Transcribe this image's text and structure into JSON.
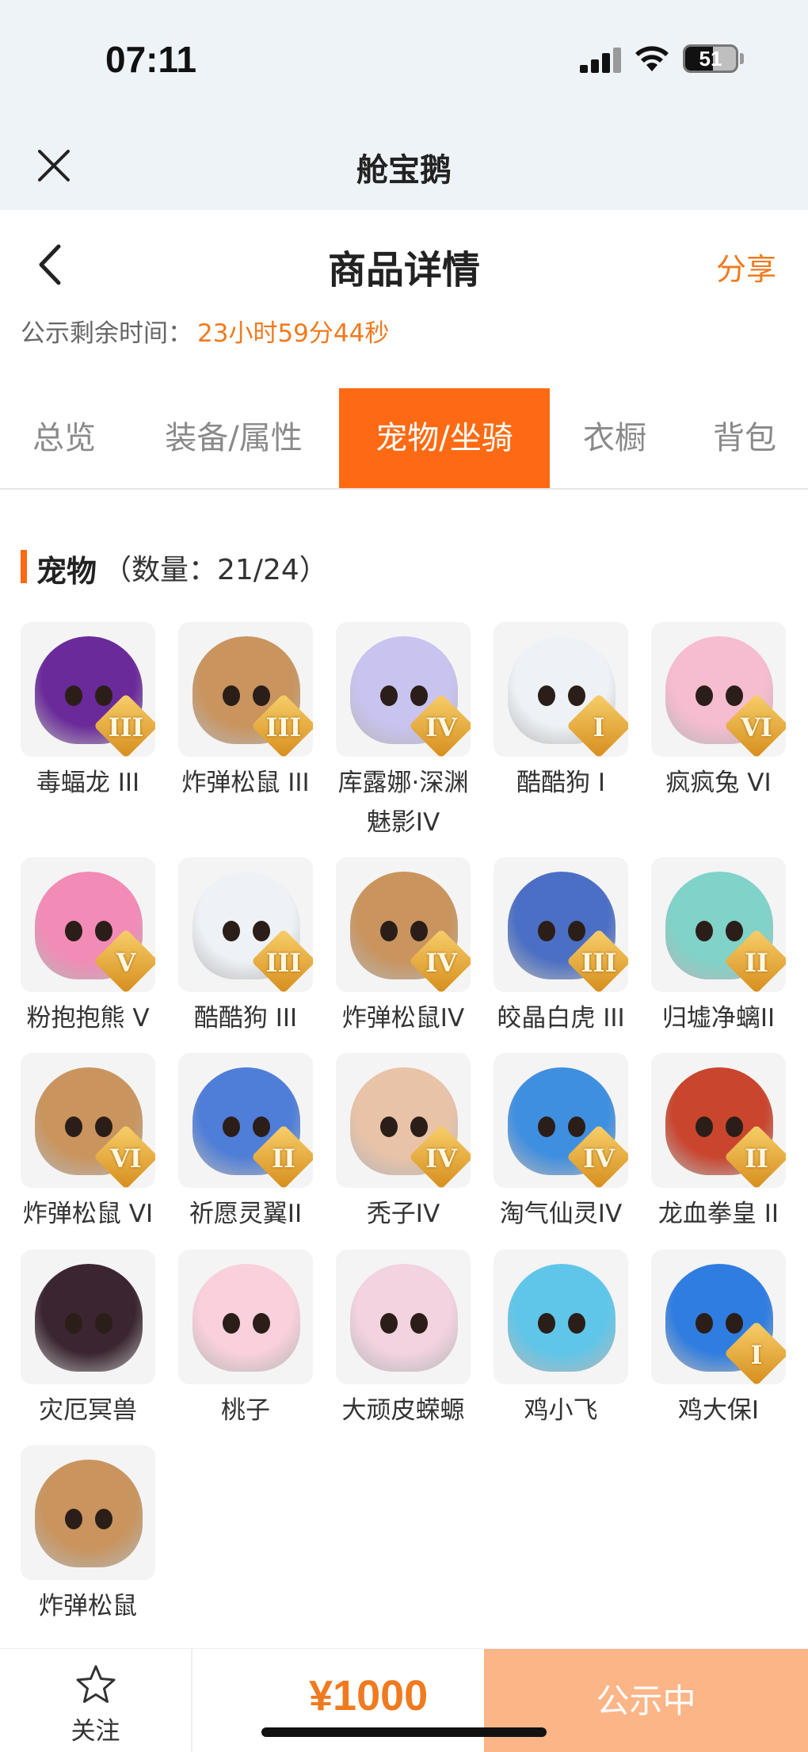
{
  "status_bar": {
    "time": "07:11",
    "battery": "51"
  },
  "app": {
    "title": "舱宝鹅"
  },
  "page": {
    "title": "商品详情",
    "share_label": "分享",
    "countdown_label": "公示剩余时间：",
    "countdown_value": "23小时59分44秒"
  },
  "tabs": [
    {
      "label": "总览",
      "active": false
    },
    {
      "label": "装备/属性",
      "active": false
    },
    {
      "label": "宠物/坐骑",
      "active": true
    },
    {
      "label": "衣橱",
      "active": false
    },
    {
      "label": "背包",
      "active": false
    }
  ],
  "section": {
    "title": "宠物",
    "count": "（数量：21/24）"
  },
  "pets": [
    {
      "name": "毒蝠龙 III",
      "tier": "III",
      "icon": "purple-dragon",
      "color": "#6a2a9a"
    },
    {
      "name": "炸弹松鼠 III",
      "tier": "III",
      "icon": "squirrel",
      "color": "#c9945e"
    },
    {
      "name": "库露娜·深渊魅影IV",
      "tier": "IV",
      "icon": "spirit-girl",
      "color": "#c9c3f0"
    },
    {
      "name": "酷酷狗 I",
      "tier": "I",
      "icon": "goggle-dog",
      "color": "#eef2f6"
    },
    {
      "name": "疯疯兔 VI",
      "tier": "VI",
      "icon": "bunny",
      "color": "#f6bcd0"
    },
    {
      "name": "粉抱抱熊 V",
      "tier": "V",
      "icon": "pink-bear",
      "color": "#f28bb6"
    },
    {
      "name": "酷酷狗 III",
      "tier": "III",
      "icon": "goggle-dog",
      "color": "#eef2f6"
    },
    {
      "name": "炸弹松鼠IV",
      "tier": "IV",
      "icon": "squirrel",
      "color": "#c9945e"
    },
    {
      "name": "皎晶白虎 III",
      "tier": "III",
      "icon": "white-tiger",
      "color": "#4b6fc4"
    },
    {
      "name": "归墟净螭II",
      "tier": "II",
      "icon": "jade-dragon",
      "color": "#7fd3c8"
    },
    {
      "name": "炸弹松鼠 VI",
      "tier": "VI",
      "icon": "squirrel",
      "color": "#c9945e"
    },
    {
      "name": "祈愿灵翼II",
      "tier": "II",
      "icon": "griffin",
      "color": "#4f7ed8"
    },
    {
      "name": "秃子IV",
      "tier": "IV",
      "icon": "bald-boy",
      "color": "#e9c3a8"
    },
    {
      "name": "淘气仙灵IV",
      "tier": "IV",
      "icon": "blue-pup",
      "color": "#3f8fe0"
    },
    {
      "name": "龙血拳皇 II",
      "tier": "II",
      "icon": "bull-demon",
      "color": "#c9452e"
    },
    {
      "name": "灾厄冥兽",
      "tier": "",
      "icon": "dark-beast",
      "color": "#3a2530"
    },
    {
      "name": "桃子",
      "tier": "",
      "icon": "pink-cat",
      "color": "#fad0dc"
    },
    {
      "name": "大顽皮蝾螈",
      "tier": "",
      "icon": "axolotl",
      "color": "#f3d3e0"
    },
    {
      "name": "鸡小飞",
      "tier": "",
      "icon": "blue-chick",
      "color": "#5fc6ea"
    },
    {
      "name": "鸡大保I",
      "tier": "I",
      "icon": "cool-chick",
      "color": "#2f7de0"
    },
    {
      "name": "炸弹松鼠",
      "tier": "",
      "icon": "squirrel",
      "color": "#c9945e"
    }
  ],
  "bottom": {
    "follow_label": "关注",
    "price": "¥1000",
    "cta_label": "公示中"
  },
  "colors": {
    "accent": "#fd6a13",
    "accent_text": "#f07a1f",
    "cta_bg": "#fcb587",
    "header_bg": "#eef3f7"
  }
}
